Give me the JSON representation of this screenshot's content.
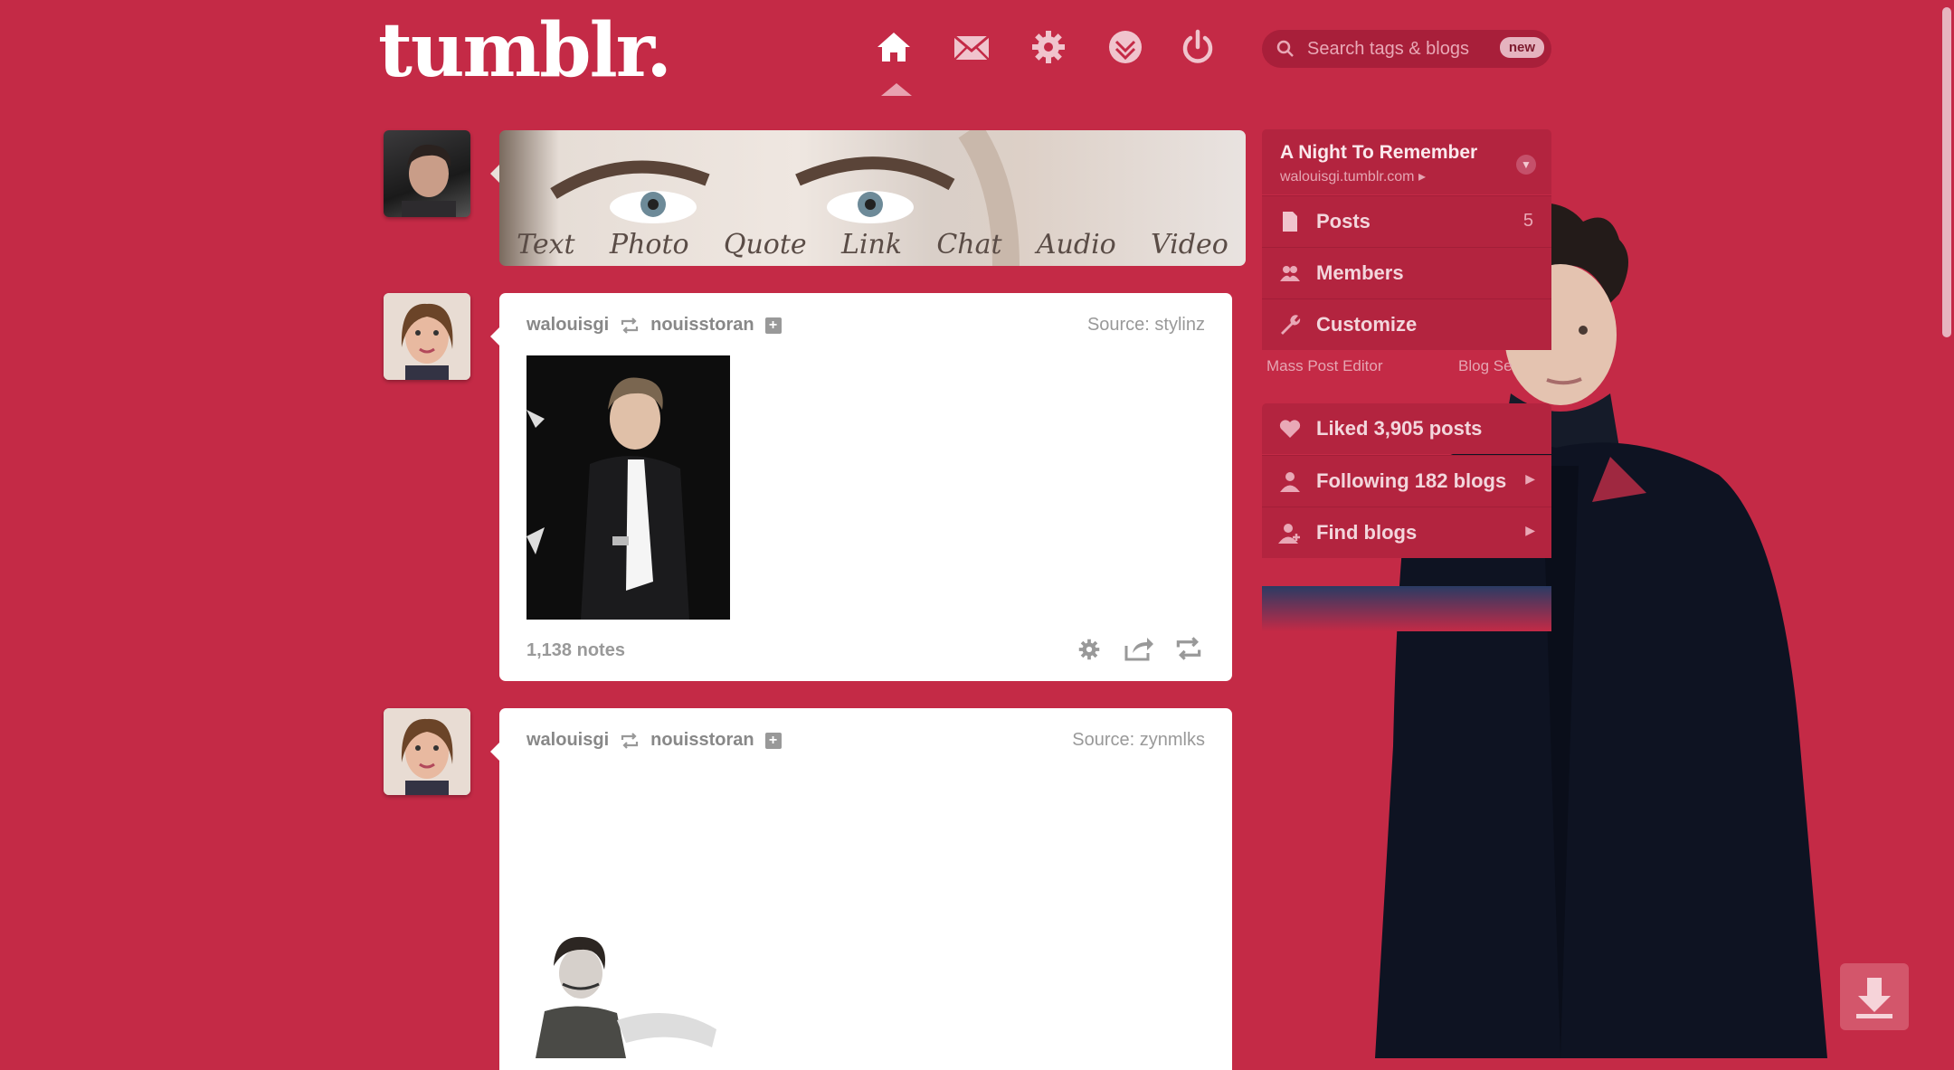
{
  "header": {
    "logo": "tumblr.",
    "search_placeholder": "Search tags & blogs",
    "search_badge": "new",
    "nav": [
      "home-icon",
      "mail-icon",
      "gear-icon",
      "explore-icon",
      "power-icon"
    ]
  },
  "post_types": [
    "Text",
    "Photo",
    "Quote",
    "Link",
    "Chat",
    "Audio",
    "Video"
  ],
  "posts": [
    {
      "author": "walouisgi",
      "reblogged_from": "nouisstoran",
      "source": "Source: stylinz",
      "notes": "1,138 notes"
    },
    {
      "author": "walouisgi",
      "reblogged_from": "nouisstoran",
      "source": "Source: zynmlks"
    }
  ],
  "sidebar": {
    "blog_title": "A Night To Remember",
    "blog_url": "walouisgi.tumblr.com",
    "blog_items": [
      {
        "label": "Posts",
        "icon": "document-icon"
      },
      {
        "label": "Members",
        "icon": "people-icon"
      },
      {
        "label": "Customize",
        "icon": "wrench-icon"
      }
    ],
    "mass_post_editor": "Mass Post Editor",
    "blog_settings": "Blog Se",
    "social_items": [
      {
        "label": "Liked 3,905 posts",
        "icon": "heart-icon"
      },
      {
        "label": "Following 182 blogs",
        "icon": "person-icon"
      },
      {
        "label": "Find blogs",
        "icon": "person-plus-icon"
      }
    ],
    "posts_count": "5"
  },
  "colors": {
    "background": "#c42a46",
    "panel": "#b3243f",
    "card": "#ffffff"
  }
}
